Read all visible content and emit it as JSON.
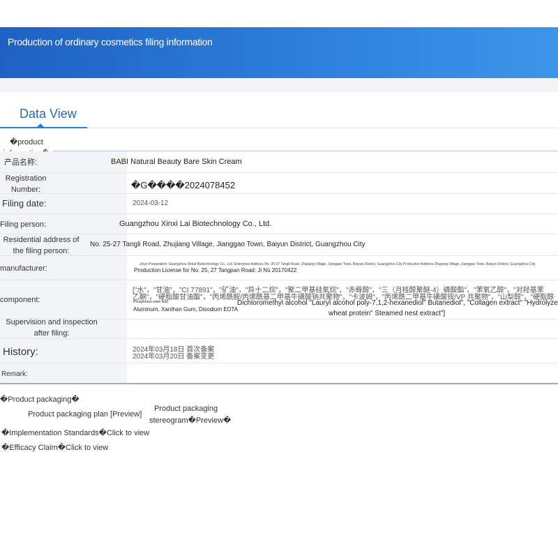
{
  "banner": {
    "title": "Production of ordinary cosmetics filing information"
  },
  "tab": {
    "label": "Data View"
  },
  "section": {
    "product_info": "�product information�"
  },
  "rows": {
    "product_name": {
      "label": "产品名称:",
      "value": "BABI Natural Beauty Bare Skin Cream"
    },
    "registration": {
      "label": "Registration Number:",
      "value": "�G����2024078452"
    },
    "filing_date": {
      "label": "Filing date:",
      "value": "2024-03-12"
    },
    "filing_person": {
      "label": "Filing person:",
      "value": "Guangzhou Xinxi Lai Biotechnology Co., Ltd."
    },
    "address": {
      "label": "Residential address of the filing person:",
      "value": "No. 25-27 Tangli Road, Zhujiang Village, Jianggao Town, Baiyun District, Guangzhou City"
    },
    "manufacturer": {
      "label": "manufacturer:",
      "value_small": "Jinye Preparation: Guangzhou Xinlai Biotechnology Co., Ltd. Enterprise Address No. 25-27 Tangli Road, Zhujiang Village, Jianggao Town, Baiyun District, Guangzhou City Production Address Zhujiang Village, Jianggao Town, Baiyun District, Guangzhou City",
      "value": "Production License for No. 25, 27 Tangpan Road: Ji Nü 20170422"
    },
    "component": {
      "label": "component:",
      "line1": "[\"水\"，\"甘油\"，\"CI 77891\"，\"矿油\"，\"异十二烷\"，\"聚二甲基硅氧烷\"，\"赤藓醇\"，\"三（月桂醇聚醚-4）磷酸酯\"，\"苯氧乙醇\"，\"对羟基苯",
      "line2": "乙酮\"，\"硬脂酸甘油酯\"，\"丙烯酰胺/丙烯酰基二甲基牛磺酸钠共聚物\"，\"卡波姆\"，\"丙烯酰二甲基牛磺酸铵/VP 共聚物\"，\"山梨醇\"，\"硬脂醇磷酸酯\"，\"鲸蜡",
      "small1": "Phosphorus ester fluid",
      "small2": "Aluminum, Xanthan Gum, Disodium EDTA",
      "line3": "Dichloromethyl alcohol \"Lauryl alcohol poly-7,1,2-hexanediol\" Butanediol\", \"Collagen extract\" \"Hydrolyzed",
      "line4": "wheat protein\" Steamed nest extract\"]"
    },
    "supervision": {
      "label": "Supervision and inspection after filing:",
      "value": ""
    },
    "history": {
      "label": "History:",
      "line1": "2024年03月18日 首次备案",
      "line2": "2024年03月20日 备案变更"
    },
    "remark": {
      "label": "Remark:",
      "value": ""
    }
  },
  "links": {
    "packaging_head": "�Product packaging�",
    "packaging_plan": "Product packaging plan",
    "packaging_plan_preview": "[Preview]",
    "stereogram_line1": "Product packaging",
    "stereogram_line2": "stereogram�Preview�",
    "standards": "�Implementation Standards�Click to view",
    "efficacy": "�Efficacy Claim�Click to view"
  },
  "colors": {
    "banner": "#2d7fdc",
    "tab_accent": "#2a7fd8",
    "label_bg": "#f3f4f6"
  }
}
